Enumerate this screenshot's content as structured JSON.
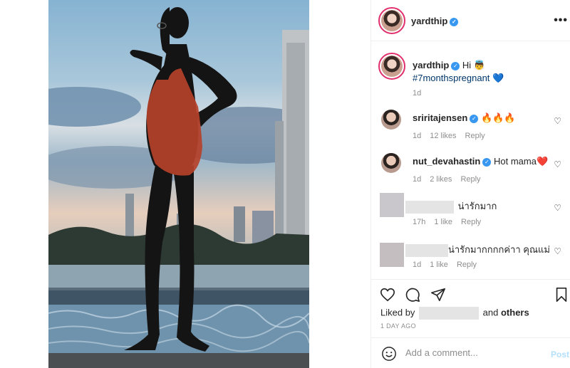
{
  "post": {
    "author": "yardthip",
    "verified_mark": "✓",
    "more_icon": "•••",
    "caption": {
      "username": "yardthip",
      "text_before": "Hi 👼",
      "hashtag": "#7monthspregnant",
      "trailing_emoji": "💙",
      "age": "1d"
    }
  },
  "comments": [
    {
      "username": "sriritajensen",
      "verified": true,
      "text": "🔥🔥🔥",
      "age": "1d",
      "likes": "12 likes",
      "reply": "Reply"
    },
    {
      "username": "nut_devahastin",
      "verified": true,
      "text": "Hot mama❤️",
      "age": "1d",
      "likes": "2 likes",
      "reply": "Reply"
    },
    {
      "username": "",
      "verified": false,
      "text": "น่ารักมาก",
      "age": "17h",
      "likes": "1 like",
      "reply": "Reply"
    },
    {
      "username": "",
      "verified": false,
      "text": "น่ารักมากกกกค่าา คุณแม่",
      "age": "1d",
      "likes": "1 like",
      "reply": "Reply"
    }
  ],
  "actions": {
    "liked_by_prefix": "Liked by",
    "liked_by_suffix": "and others",
    "timestamp": "1 DAY AGO"
  },
  "composer": {
    "placeholder": "Add a comment...",
    "post_label": "Post"
  },
  "icons": {
    "like": "heart-outline-icon",
    "comment": "comment-bubble-icon",
    "share": "paper-plane-icon",
    "save": "bookmark-icon",
    "emoji": "smiley-icon"
  },
  "colors": {
    "verified": "#3897f0",
    "hashtag": "#00376b",
    "post_disabled": "#b2dffc",
    "story_ring": "#e1306c"
  }
}
